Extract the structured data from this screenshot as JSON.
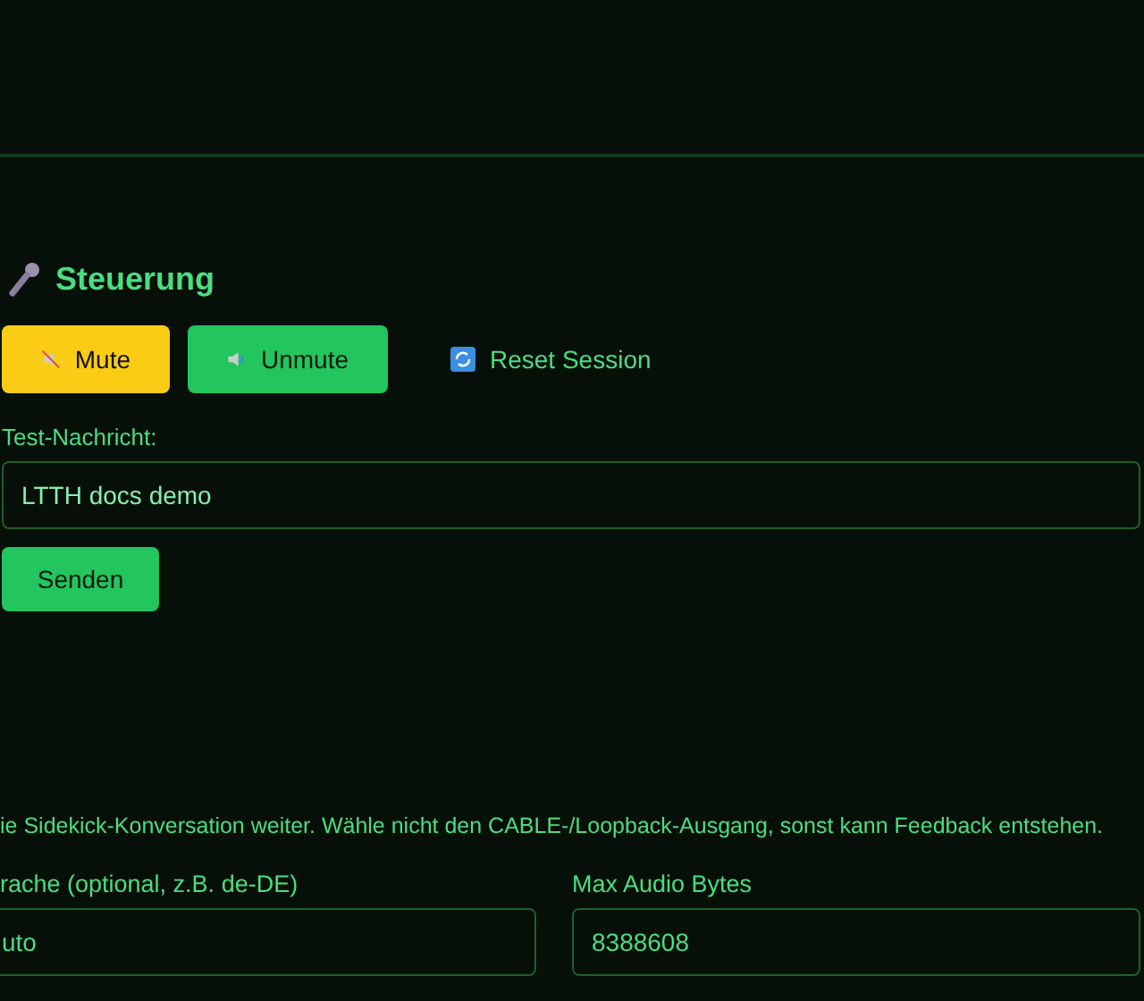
{
  "section": {
    "title": "Steuerung"
  },
  "buttons": [
    {
      "label": "Mute",
      "kind": "warning"
    },
    {
      "label": "Unmute",
      "kind": "success"
    },
    {
      "label": "Reset Session",
      "kind": "ghost"
    }
  ],
  "message": {
    "label": "Test-Nachricht:",
    "value": "LTTH docs demo",
    "send": "Senden"
  },
  "note": "ie Sidekick-Konversation weiter. Wähle nicht den CABLE-/Loopback-Ausgang, sonst kann Feedback entstehen.",
  "fields": [
    {
      "label": "rache (optional, z.B. de-DE)",
      "value": "uto"
    },
    {
      "label": "Max Audio Bytes",
      "value": "8388608"
    }
  ]
}
